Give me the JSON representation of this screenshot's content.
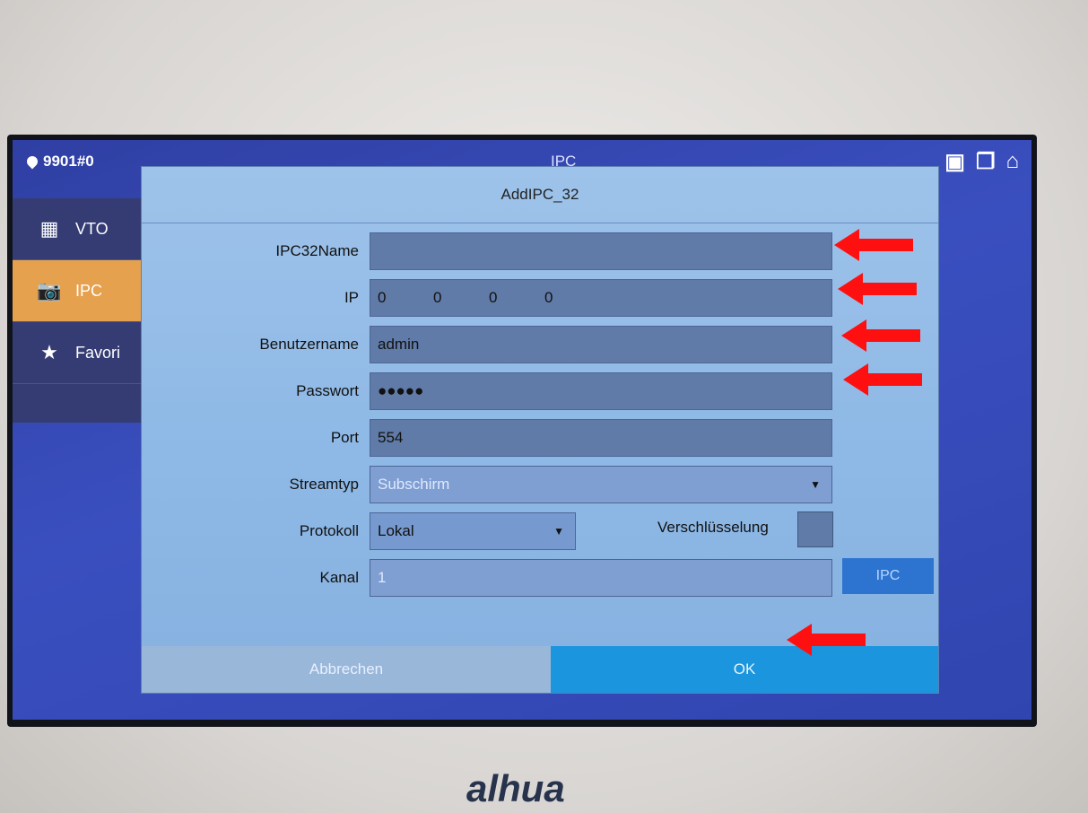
{
  "status_bar": {
    "room": "9901#0",
    "title": "IPC"
  },
  "sidebar": {
    "items": [
      {
        "label": "VTO",
        "icon": "intercom-icon"
      },
      {
        "label": "IPC",
        "icon": "camera-icon",
        "active": true
      },
      {
        "label": "Favori",
        "icon": "star-icon"
      }
    ]
  },
  "dialog": {
    "title": "AddIPC_32",
    "fields": {
      "name_label": "IPC32Name",
      "name_value": "",
      "ip_label": "IP",
      "ip_parts": [
        "0",
        "0",
        "0",
        "0"
      ],
      "user_label": "Benutzername",
      "user_value": "admin",
      "pass_label": "Passwort",
      "pass_value": "●●●●●",
      "port_label": "Port",
      "port_value": "554",
      "stream_label": "Streamtyp",
      "stream_value": "Subschirm",
      "proto_label": "Protokoll",
      "proto_value": "Lokal",
      "encryption_label": "Verschlüsselung",
      "channel_label": "Kanal",
      "channel_value": "1"
    },
    "buttons": {
      "ipc": "IPC",
      "cancel": "Abbrechen",
      "ok": "OK"
    }
  },
  "brand": "alhua",
  "colors": {
    "arrow": "#ff1010",
    "ok_button": "#1a95de",
    "sidebar_active": "#e5a14d"
  }
}
